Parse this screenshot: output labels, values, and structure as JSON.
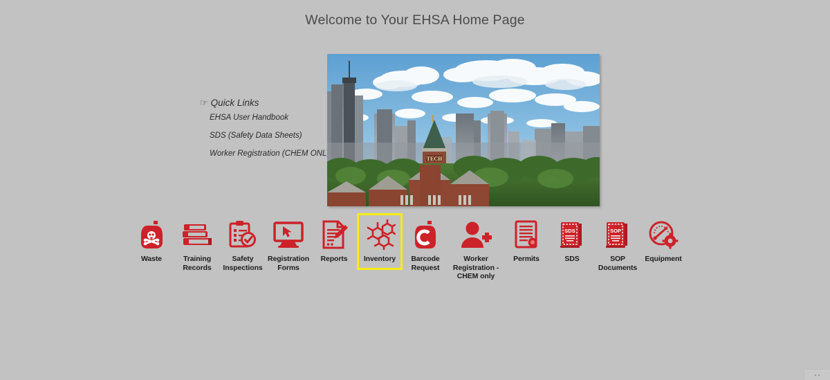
{
  "page": {
    "title": "Welcome to Your EHSA Home Page",
    "background_color": "#c2c2c2"
  },
  "quick_links": {
    "icon": "pointing-hand-icon",
    "heading": "Quick Links",
    "items": [
      {
        "label": "EHSA User Handbook"
      },
      {
        "label": "SDS (Safety Data Sheets)"
      },
      {
        "label": "Worker Registration (CHEM ONLY)"
      }
    ]
  },
  "hero": {
    "alt": "Atlanta skyline with Georgia Tech Tech Tower",
    "tower_text": "TECH"
  },
  "icon_strip": {
    "accent_color": "#cc2229",
    "highlight_color": "#f7ec13",
    "selected": "Inventory",
    "tiles": [
      {
        "label": "Waste",
        "icon": "hazard-bottle-skull-icon",
        "selected": false
      },
      {
        "label": "Training Records",
        "icon": "stacked-books-icon",
        "selected": false
      },
      {
        "label": "Safety Inspections",
        "icon": "clipboard-check-icon",
        "selected": false
      },
      {
        "label": "Registration Forms",
        "icon": "monitor-cursor-icon",
        "selected": false
      },
      {
        "label": "Reports",
        "icon": "document-pen-icon",
        "selected": false
      },
      {
        "label": "Inventory",
        "icon": "molecule-structure-icon",
        "selected": true
      },
      {
        "label": "Barcode Request",
        "icon": "bottle-letter-c-icon",
        "selected": false
      },
      {
        "label": "Worker Registration - CHEM only",
        "icon": "person-plus-icon",
        "selected": false
      },
      {
        "label": "Permits",
        "icon": "certificate-seal-icon",
        "selected": false
      },
      {
        "label": "SDS",
        "icon": "sds-book-icon",
        "selected": false
      },
      {
        "label": "SOP Documents",
        "icon": "sop-book-icon",
        "selected": false
      },
      {
        "label": "Equipment",
        "icon": "gauge-gear-icon",
        "selected": false
      }
    ]
  },
  "book_labels": {
    "sds": "SDS",
    "sop": "SOP"
  }
}
